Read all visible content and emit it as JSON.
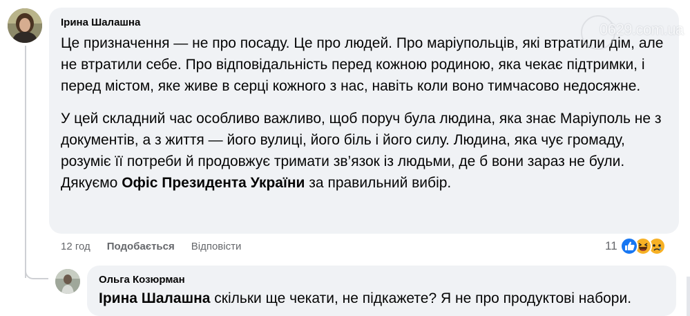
{
  "comment": {
    "author": "Ірина Шалашна",
    "paragraphs": [
      "Це призначення — не про посаду. Це про людей. Про маріупольців, які втратили дім, але не втратили себе. Про відповідальність перед кожною родиною, яка чекає підтримки, і перед містом, яке живе в серці кожного з нас, навіть коли воно тимчасово недосяжне.",
      "У цей складний час особливо важливо, щоб поруч була людина, яка знає Маріуполь не з документів, а з життя — його вулиці, його біль і його силу. Людина, яка чує громаду, розуміє її потреби й продовжує тримати зв’язок із людьми, де б вони зараз не були."
    ],
    "thanks_prefix": "Дякуємо ",
    "thanks_bold": "Офіс Президента України",
    "thanks_suffix": " за правильний вибір.",
    "time": "12 год",
    "like_label": "Подобається",
    "reply_label": "Відповісти",
    "reaction_count": "11",
    "reactions": [
      "like-icon",
      "haha-icon",
      "sad-icon"
    ]
  },
  "reply": {
    "author": "Ольга Козюрман",
    "mention": "Ірина Шалашна",
    "text": " скільки ще чекати, не підкажете? Я не про продуктові набори."
  },
  "watermark": {
    "text": "0629.com.ua"
  },
  "colors": {
    "bubble": "#f0f2f5",
    "meta": "#65676b",
    "like_blue": "#1877f2",
    "reaction_yellow": "#f7b125"
  }
}
